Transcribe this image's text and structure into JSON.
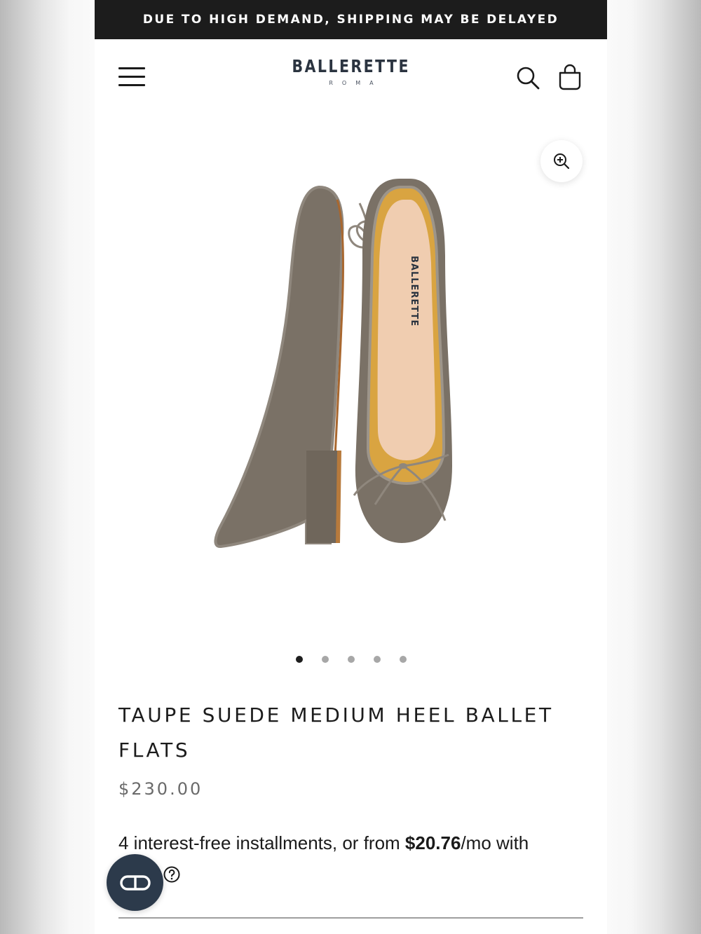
{
  "announcement": {
    "text": "DUE TO HIGH DEMAND, SHIPPING MAY BE DELAYED"
  },
  "header": {
    "logo_text": "BALLERETTE",
    "logo_subtext": "ROMA",
    "menu_icon": "hamburger-menu-icon",
    "search_icon": "search-icon",
    "cart_icon": "shopping-bag-icon"
  },
  "gallery": {
    "zoom_icon": "zoom-in-icon",
    "image_subject": "taupe suede ballet flats with bow, top view",
    "current_slide": 1,
    "slide_count": 5
  },
  "product": {
    "title": "TAUPE SUEDE MEDIUM HEEL BALLET FLATS",
    "price": "$230.00"
  },
  "installments": {
    "prefix": "4 interest-free installments, or from ",
    "amount": "$20.76",
    "suffix": "/mo with"
  },
  "colors": {
    "announcement_bg": "#1c1c1c",
    "chat_button_bg": "#2c3a4b",
    "suede_taupe": "#7a7166",
    "insole_pink": "#f0cdb0"
  }
}
